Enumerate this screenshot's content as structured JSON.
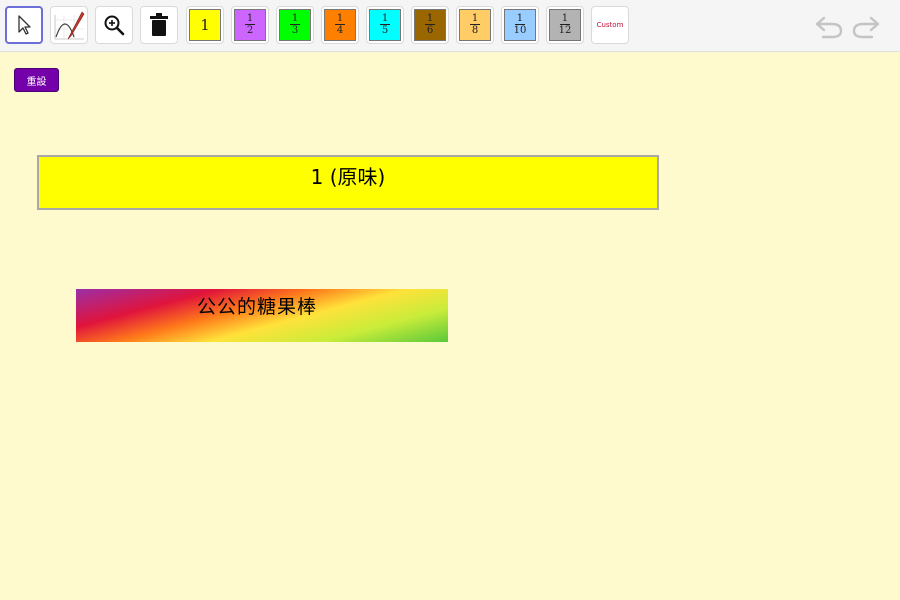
{
  "toolbar": {
    "tools": [
      {
        "name": "move-tool",
        "icon": "cursor-arrow-icon",
        "selected": true
      },
      {
        "name": "pen-tool",
        "icon": "pen-graph-icon",
        "selected": false
      },
      {
        "name": "zoom-tool",
        "icon": "zoom-in-icon",
        "selected": false
      },
      {
        "name": "delete-tool",
        "icon": "trash-icon",
        "selected": false
      }
    ],
    "swatches": [
      {
        "label": "1",
        "numerator": "",
        "denominator": "",
        "color": "#ffff00"
      },
      {
        "label": "",
        "numerator": "1",
        "denominator": "2",
        "color": "#cc66ff"
      },
      {
        "label": "",
        "numerator": "1",
        "denominator": "3",
        "color": "#00ff00"
      },
      {
        "label": "",
        "numerator": "1",
        "denominator": "4",
        "color": "#ff8000"
      },
      {
        "label": "",
        "numerator": "1",
        "denominator": "5",
        "color": "#00ffff"
      },
      {
        "label": "",
        "numerator": "1",
        "denominator": "6",
        "color": "#996600"
      },
      {
        "label": "",
        "numerator": "1",
        "denominator": "8",
        "color": "#ffcc66"
      },
      {
        "label": "",
        "numerator": "1",
        "denominator": "10",
        "color": "#99ccff"
      },
      {
        "label": "",
        "numerator": "1",
        "denominator": "12",
        "color": "#b3b3b3"
      }
    ],
    "custom_label": "Custom",
    "undo_icon": "undo-icon",
    "redo_icon": "redo-icon"
  },
  "reset_button": {
    "label": "重設",
    "color": "#7300a8"
  },
  "bar_one": {
    "label": "1 (原味)",
    "color": "#ffff00"
  },
  "candy_bar": {
    "label": "公公的糖果棒"
  }
}
